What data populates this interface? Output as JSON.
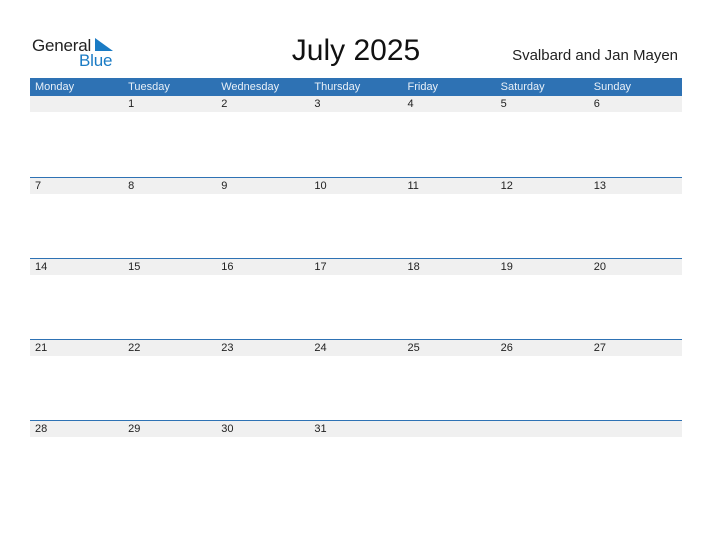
{
  "logo": {
    "word1": "General",
    "word2": "Blue"
  },
  "title": "July 2025",
  "region": "Svalbard and Jan Mayen",
  "weekdays": [
    "Monday",
    "Tuesday",
    "Wednesday",
    "Thursday",
    "Friday",
    "Saturday",
    "Sunday"
  ],
  "weeks": [
    [
      "",
      "1",
      "2",
      "3",
      "4",
      "5",
      "6"
    ],
    [
      "7",
      "8",
      "9",
      "10",
      "11",
      "12",
      "13"
    ],
    [
      "14",
      "15",
      "16",
      "17",
      "18",
      "19",
      "20"
    ],
    [
      "21",
      "22",
      "23",
      "24",
      "25",
      "26",
      "27"
    ],
    [
      "28",
      "29",
      "30",
      "31",
      "",
      "",
      ""
    ]
  ],
  "colors": {
    "accent": "#2e72b4",
    "logo_blue": "#1a7bc4",
    "stripe": "#f0f0f0"
  }
}
